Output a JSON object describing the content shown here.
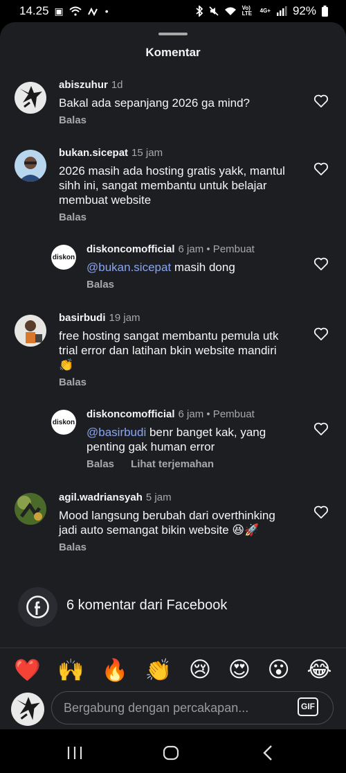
{
  "status_bar": {
    "time": "14.25",
    "volte": "Vo) LTE",
    "network": "4G+",
    "battery": "92%"
  },
  "sheet": {
    "title": "Komentar"
  },
  "comments": [
    {
      "username": "abiszuhur",
      "time": "1d",
      "author_badge": "",
      "mention": "",
      "text": "Bakal ada sepanjang 2026 ga mind?",
      "reply_label": "Balas",
      "translate_label": ""
    },
    {
      "username": "bukan.sicepat",
      "time": "15 jam",
      "author_badge": "",
      "mention": "",
      "text": "2026 masih ada hosting gratis yakk, mantul sihh ini, sangat membantu untuk belajar membuat website",
      "reply_label": "Balas",
      "translate_label": ""
    },
    {
      "username": "diskoncomofficial",
      "time": "6 jam",
      "author_badge": "• Pembuat",
      "mention": "@bukan.sicepat",
      "text": " masih dong",
      "reply_label": "Balas",
      "translate_label": ""
    },
    {
      "username": "basirbudi",
      "time": "19 jam",
      "author_badge": "",
      "mention": "",
      "text": "free hosting sangat membantu pemula utk trial error dan latihan bkin website mandiri 👏",
      "reply_label": "Balas",
      "translate_label": ""
    },
    {
      "username": "diskoncomofficial",
      "time": "6 jam",
      "author_badge": "• Pembuat",
      "mention": "@basirbudi",
      "text": " benr banget kak, yang penting gak human error",
      "reply_label": "Balas",
      "translate_label": "Lihat terjemahan"
    },
    {
      "username": "agil.wadriansyah",
      "time": "5 jam",
      "author_badge": "",
      "mention": "",
      "text": "Mood langsung berubah dari overthinking jadi auto semangat bikin website 😆🚀",
      "reply_label": "Balas",
      "translate_label": ""
    }
  ],
  "facebook": {
    "label": "6 komentar dari Facebook",
    "icon": "facebook-icon"
  },
  "quick_reactions": [
    "❤️",
    "🙌",
    "🔥",
    "👏",
    "😢",
    "😍",
    "😮",
    "😂"
  ],
  "composer": {
    "placeholder": "Bergabung dengan percakapan...",
    "gif_label": "GIF"
  },
  "logo_text": "diskon",
  "colors": {
    "background": "#1c1e22",
    "mention": "#8aa5f0",
    "muted": "#a8a8a8"
  }
}
